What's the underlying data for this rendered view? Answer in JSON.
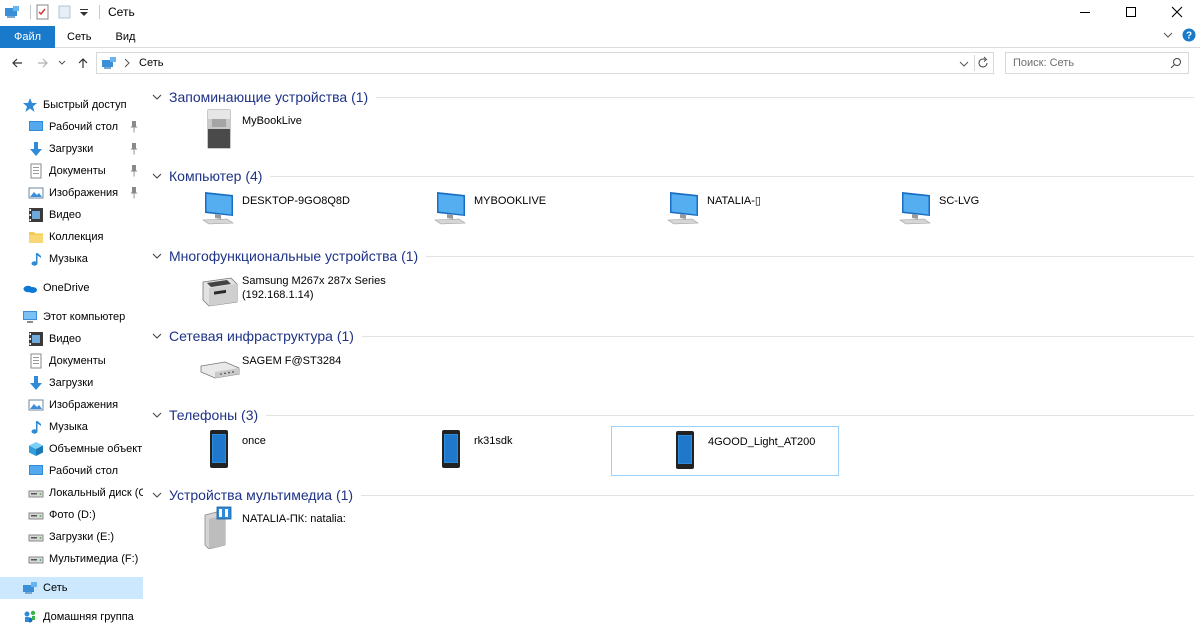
{
  "window": {
    "title": "Сеть",
    "buttons": {
      "minimize": "—",
      "maximize": "☐",
      "close": "✕"
    }
  },
  "ribbon": {
    "tabs": [
      {
        "label": "Файл",
        "active": true
      },
      {
        "label": "Сеть",
        "active": false
      },
      {
        "label": "Вид",
        "active": false
      }
    ],
    "accent_color": "#1979ca"
  },
  "address": {
    "crumb": "Сеть",
    "search_placeholder": "Поиск: Сеть"
  },
  "sidebar": {
    "items": [
      {
        "label": "Быстрый доступ",
        "icon": "star-icon",
        "level": 0,
        "pinned": false
      },
      {
        "label": "Рабочий стол",
        "icon": "desktop-icon",
        "level": 1,
        "pinned": true
      },
      {
        "label": "Загрузки",
        "icon": "download-icon",
        "level": 1,
        "pinned": true
      },
      {
        "label": "Документы",
        "icon": "documents-icon",
        "level": 1,
        "pinned": true
      },
      {
        "label": "Изображения",
        "icon": "pictures-icon",
        "level": 1,
        "pinned": true
      },
      {
        "label": "Видео",
        "icon": "video-icon",
        "level": 1,
        "pinned": false
      },
      {
        "label": "Коллекция",
        "icon": "folder-icon",
        "level": 1,
        "pinned": false
      },
      {
        "label": "Музыка",
        "icon": "music-icon",
        "level": 1,
        "pinned": false
      },
      {
        "label": "OneDrive",
        "icon": "onedrive-icon",
        "level": 0,
        "pinned": false
      },
      {
        "label": "Этот компьютер",
        "icon": "computer-icon",
        "level": 0,
        "pinned": false
      },
      {
        "label": "Видео",
        "icon": "video-icon",
        "level": 1,
        "pinned": false
      },
      {
        "label": "Документы",
        "icon": "documents-icon",
        "level": 1,
        "pinned": false
      },
      {
        "label": "Загрузки",
        "icon": "download-icon",
        "level": 1,
        "pinned": false
      },
      {
        "label": "Изображения",
        "icon": "pictures-icon",
        "level": 1,
        "pinned": false
      },
      {
        "label": "Музыка",
        "icon": "music-icon",
        "level": 1,
        "pinned": false
      },
      {
        "label": "Объемные объекты",
        "icon": "3d-objects-icon",
        "level": 1,
        "pinned": false
      },
      {
        "label": "Рабочий стол",
        "icon": "desktop-icon",
        "level": 1,
        "pinned": false
      },
      {
        "label": "Локальный диск (C:)",
        "icon": "drive-icon",
        "level": 1,
        "pinned": false
      },
      {
        "label": "Фото (D:)",
        "icon": "drive-icon",
        "level": 1,
        "pinned": false
      },
      {
        "label": "Загрузки (E:)",
        "icon": "drive-icon",
        "level": 1,
        "pinned": false
      },
      {
        "label": "Мультимедиа (F:)",
        "icon": "drive-icon",
        "level": 1,
        "pinned": false
      },
      {
        "label": "Сеть",
        "icon": "network-icon",
        "level": 0,
        "pinned": false,
        "selected": true
      },
      {
        "label": "Домашняя группа",
        "icon": "homegroup-icon",
        "level": 0,
        "pinned": false
      }
    ]
  },
  "groups": [
    {
      "title": "Запоминающие устройства (1)",
      "items": [
        {
          "label": "MyBookLive",
          "icon": "nas-icon"
        }
      ]
    },
    {
      "title": "Компьютер (4)",
      "items": [
        {
          "label": "DESKTOP-9GO8Q8D",
          "icon": "monitor-icon"
        },
        {
          "label": "MYBOOKLIVE",
          "icon": "monitor-icon"
        },
        {
          "label": "NATALIA-▯",
          "icon": "monitor-icon"
        },
        {
          "label": "SC-LVG",
          "icon": "monitor-icon"
        }
      ]
    },
    {
      "title": "Многофункциональные устройства (1)",
      "items": [
        {
          "label": "Samsung M267x 287x Series\n(192.168.1.14)",
          "icon": "printer-icon"
        }
      ]
    },
    {
      "title": "Сетевая инфраструктура (1)",
      "items": [
        {
          "label": "SAGEM F@ST3284",
          "icon": "router-icon"
        }
      ]
    },
    {
      "title": "Телефоны (3)",
      "items": [
        {
          "label": "once",
          "icon": "phone-icon"
        },
        {
          "label": "rk31sdk",
          "icon": "phone-icon"
        },
        {
          "label": "4GOOD_Light_AT200",
          "icon": "phone-icon",
          "focused": true
        }
      ]
    },
    {
      "title": "Устройства мультимедиа (1)",
      "items": [
        {
          "label": "NATALIA-ПК: natalia:",
          "icon": "media-server-icon"
        }
      ]
    }
  ],
  "colors": {
    "group_header": "#1e3287",
    "selection": "#cce8ff",
    "focus_border": "#99d1ff"
  }
}
